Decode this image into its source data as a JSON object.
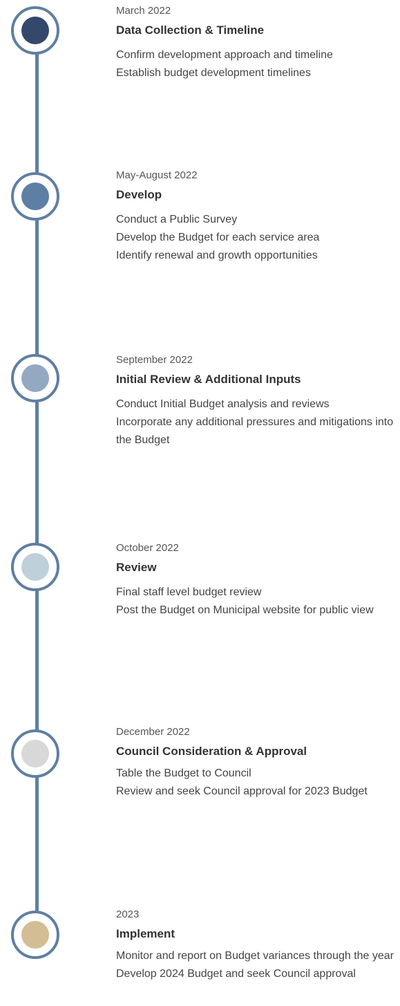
{
  "timeline": {
    "line_color": "#5f7fa3",
    "stages": [
      {
        "date": "March 2022",
        "title": "Data Collection & Timeline",
        "items": [
          "Confirm development approach and timeline",
          "Establish budget development timelines"
        ],
        "dot_color": "#34486c"
      },
      {
        "date": "May-August 2022",
        "title": "Develop",
        "items": [
          "Conduct a Public Survey",
          "Develop the Budget for each service area",
          "Identify renewal and growth opportunities"
        ],
        "dot_color": "#5d7fa4"
      },
      {
        "date": "September 2022",
        "title": "Initial Review & Additional Inputs",
        "items": [
          "Conduct Initial Budget analysis and reviews",
          "Incorporate any additional pressures and mitigations into the Budget"
        ],
        "dot_color": "#93a8c1"
      },
      {
        "date": "October 2022",
        "title": "Review",
        "items": [
          "Final staff level budget review",
          "Post the Budget on Municipal website for public view"
        ],
        "dot_color": "#bed0da"
      },
      {
        "date": "December 2022",
        "title": "Council Consideration & Approval",
        "items": [
          "Table the Budget to Council",
          "Review and seek Council approval for 2023 Budget"
        ],
        "dot_color": "#d8d8d8"
      },
      {
        "date": "2023",
        "title": "Implement",
        "items": [
          "Monitor and report on Budget variances through the year",
          "Develop 2024 Budget and seek Council approval"
        ],
        "dot_color": "#d2bd95"
      }
    ]
  }
}
